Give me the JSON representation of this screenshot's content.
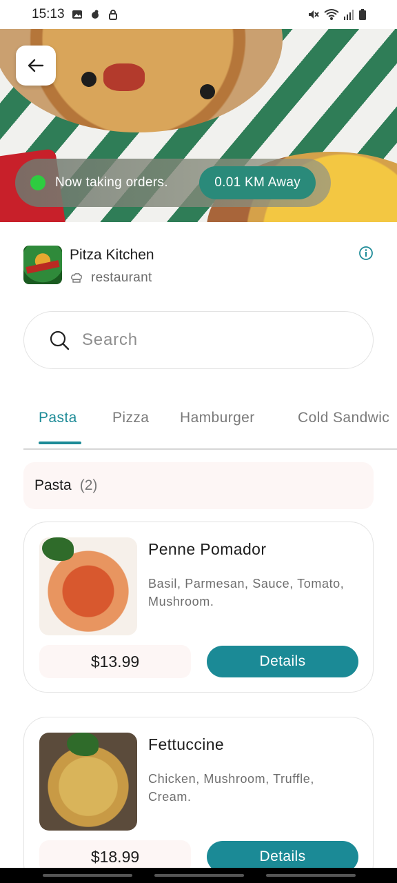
{
  "status_bar": {
    "time": "15:13"
  },
  "hero": {
    "order_status": "Now taking orders.",
    "distance": "0.01 KM Away"
  },
  "restaurant": {
    "name": "Pitza Kitchen",
    "type": "restaurant"
  },
  "search": {
    "placeholder": "Search"
  },
  "tabs": [
    {
      "label": "Pasta",
      "active": true
    },
    {
      "label": "Pizza",
      "active": false
    },
    {
      "label": "Hamburger",
      "active": false
    },
    {
      "label": "Cold Sandwic",
      "active": false
    }
  ],
  "category": {
    "title": "Pasta",
    "count": "(2)"
  },
  "items": [
    {
      "name": "Penne Pomador",
      "description": "Basil, Parmesan, Sauce, Tomato, Mushroom.",
      "price": "$13.99",
      "button": "Details"
    },
    {
      "name": "Fettuccine",
      "description": "Chicken, Mushroom, Truffle, Cream.",
      "price": "$18.99",
      "button": "Details"
    }
  ],
  "colors": {
    "accent": "#1b8a96",
    "online": "#2ecc40",
    "pill": "#2a8a7a"
  }
}
